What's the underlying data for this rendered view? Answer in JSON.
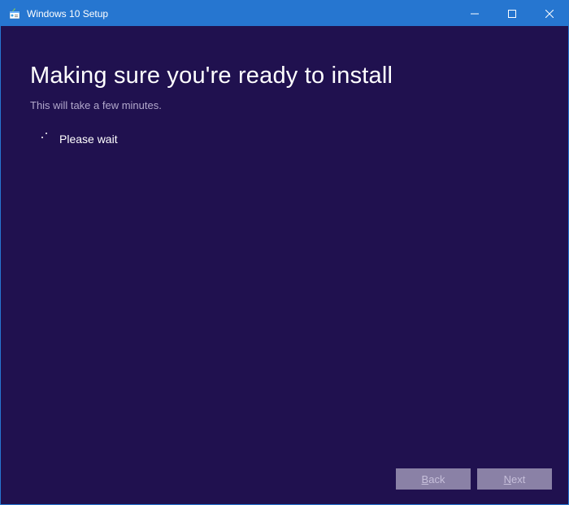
{
  "titlebar": {
    "title": "Windows 10 Setup"
  },
  "content": {
    "heading": "Making sure you're ready to install",
    "subtext": "This will take a few minutes.",
    "wait_label": "Please wait"
  },
  "buttons": {
    "back": "Back",
    "next": "Next",
    "back_mnemonic": "B",
    "next_mnemonic": "N"
  }
}
